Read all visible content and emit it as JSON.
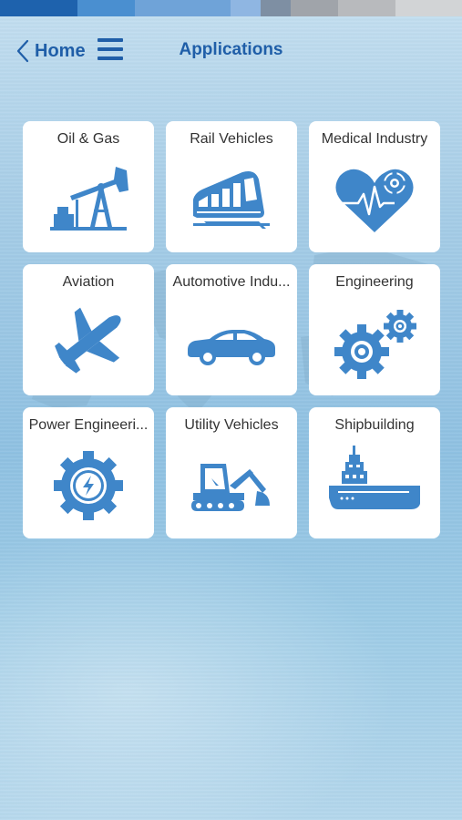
{
  "header": {
    "back_label": "Home",
    "title": "Applications",
    "icons": {
      "back": "chevron-left-icon",
      "menu": "hamburger-menu-icon"
    }
  },
  "colors": {
    "accent": "#1f5ea8",
    "icon": "#3f86c9",
    "tile_background": "#ffffff",
    "label": "#333333",
    "top_strip": [
      "#1e62ad",
      "#4a8fd0",
      "#6fa3d8",
      "#8fb6e2",
      "#7e8fa3",
      "#a0a4aa",
      "#b8babd",
      "#d2d4d6"
    ]
  },
  "tiles": [
    {
      "label": "Oil & Gas",
      "icon": "oil-pump-icon"
    },
    {
      "label": "Rail Vehicles",
      "icon": "train-icon"
    },
    {
      "label": "Medical Industry",
      "icon": "heart-gear-icon"
    },
    {
      "label": "Aviation",
      "icon": "airplane-icon"
    },
    {
      "label": "Automotive Indu...",
      "icon": "car-icon"
    },
    {
      "label": "Engineering",
      "icon": "gears-icon"
    },
    {
      "label": "Power Engineeri...",
      "icon": "power-gear-icon"
    },
    {
      "label": "Utility Vehicles",
      "icon": "excavator-icon"
    },
    {
      "label": "Shipbuilding",
      "icon": "ship-icon"
    }
  ]
}
